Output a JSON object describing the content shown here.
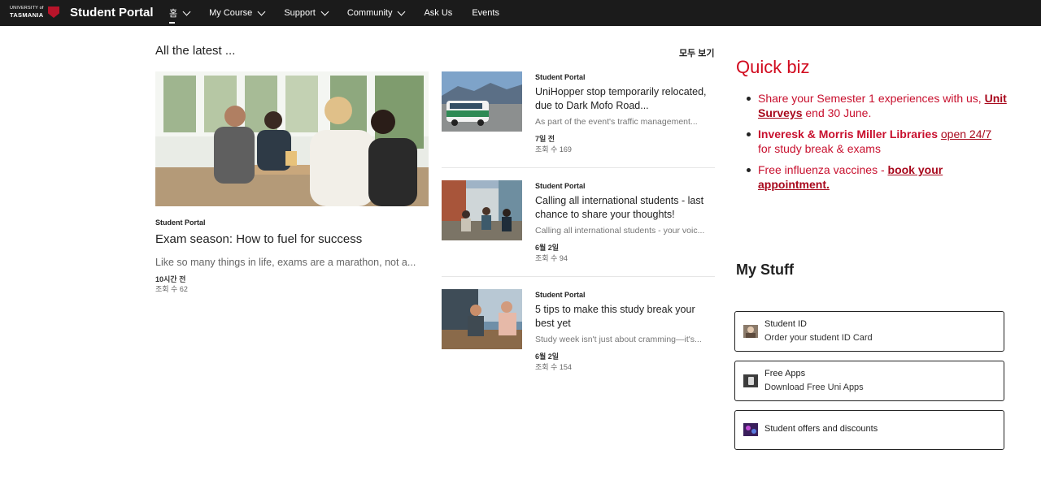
{
  "header": {
    "logo": {
      "line1": "UNIVERSITY of",
      "line2": "TASMANIA"
    },
    "site_title": "Student Portal",
    "nav": [
      {
        "label": "홈",
        "has_menu": true,
        "active": true
      },
      {
        "label": "My Course",
        "has_menu": true
      },
      {
        "label": "Support",
        "has_menu": true
      },
      {
        "label": "Community",
        "has_menu": true
      },
      {
        "label": "Ask Us",
        "has_menu": false
      },
      {
        "label": "Events",
        "has_menu": false
      }
    ]
  },
  "news": {
    "heading": "All the latest ...",
    "see_all": "모두 보기",
    "hero": {
      "source": "Student Portal",
      "title": "Exam season: How to fuel for success",
      "description": "Like so many things in life, exams are a marathon, not a...",
      "date": "10시간 전",
      "views": "조회 수 62"
    },
    "items": [
      {
        "source": "Student Portal",
        "title": "UniHopper stop temporarily relocated, due to Dark Mofo Road...",
        "description": "As part of the event's traffic management...",
        "date": "7일 전",
        "views": "조회 수 169"
      },
      {
        "source": "Student Portal",
        "title": "Calling all international students - last chance to share your thoughts!",
        "description": "Calling all international students - your voic...",
        "date": "6월 2일",
        "views": "조회 수 94"
      },
      {
        "source": "Student Portal",
        "title": "5 tips to make this study break your best yet",
        "description": "Study week isn't just about cramming—it's...",
        "date": "6월 2일",
        "views": "조회 수 154"
      }
    ]
  },
  "quick_biz": {
    "title": "Quick biz",
    "item1": {
      "text": "Share your Semester 1 experiences with us, ",
      "link": "Unit Surveys",
      "tail": " end 30 June."
    },
    "item2": {
      "bold": "Inveresk & Morris Miller Libraries",
      "link": "open 24/7",
      "tail": " for study break & exams"
    },
    "item3": {
      "text": "Free influenza vaccines - ",
      "link": "book your appointment",
      "tail": "."
    }
  },
  "my_stuff": {
    "title": "My Stuff",
    "cards": [
      {
        "title": "Student ID",
        "subtitle": "Order your student ID Card",
        "icon": "id-card-icon"
      },
      {
        "title": "Free Apps",
        "subtitle": "Download Free Uni Apps",
        "icon": "apps-icon"
      },
      {
        "title": "Student offers and discounts",
        "subtitle": "",
        "icon": "offers-icon"
      }
    ]
  },
  "colors": {
    "topbar": "#1b1b1b",
    "accent_red": "#d10a1e",
    "link_red": "#a8081c"
  }
}
